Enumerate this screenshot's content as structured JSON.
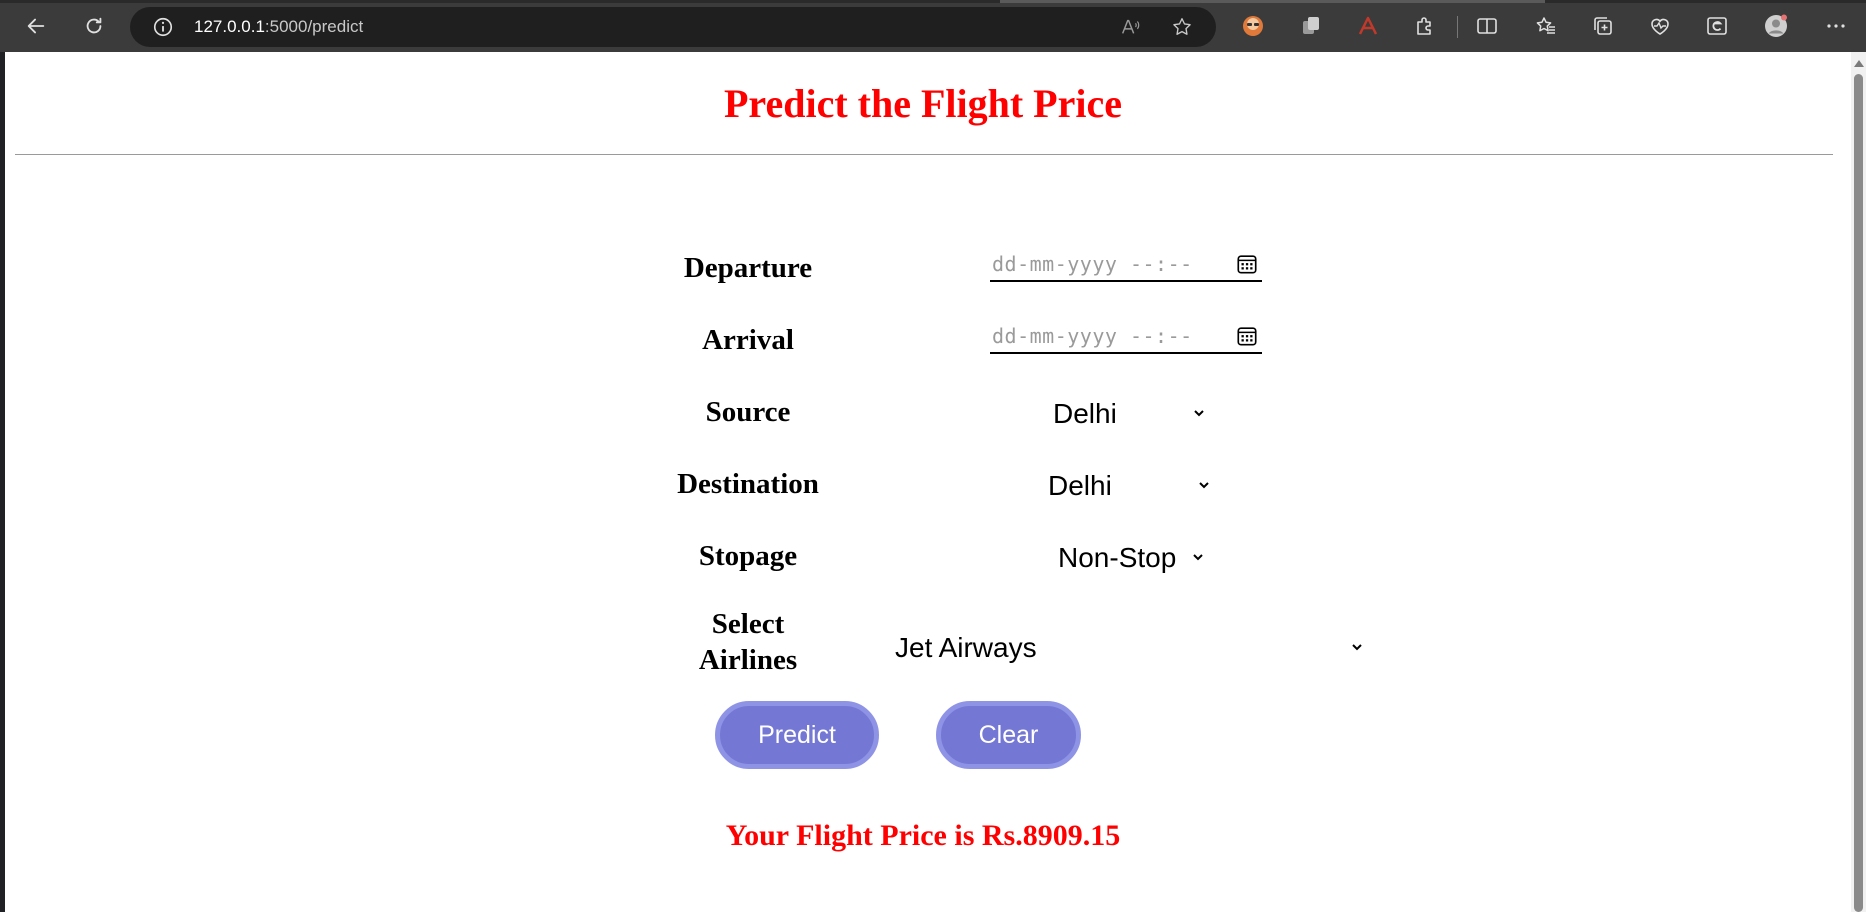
{
  "browser": {
    "url_host": "127.0.0.1",
    "url_path": ":5000/predict"
  },
  "page": {
    "title": "Predict the Flight Price",
    "result_text": "Your Flight Price is Rs.8909.15"
  },
  "form": {
    "departure": {
      "label": "Departure",
      "placeholder": "dd-mm-yyyy --:--"
    },
    "arrival": {
      "label": "Arrival",
      "placeholder": "dd-mm-yyyy --:--"
    },
    "source": {
      "label": "Source",
      "selected": "Delhi"
    },
    "destination": {
      "label": "Destination",
      "selected": "Delhi"
    },
    "stopage": {
      "label": "Stopage",
      "selected": "Non-Stop"
    },
    "airlines": {
      "label_line1": "Select",
      "label_line2": "Airlines",
      "selected": "Jet Airways"
    },
    "predict_label": "Predict",
    "clear_label": "Clear"
  },
  "colors": {
    "title": "#ff0000",
    "button_fill": "#7478d4",
    "button_border": "#8f93e6"
  }
}
